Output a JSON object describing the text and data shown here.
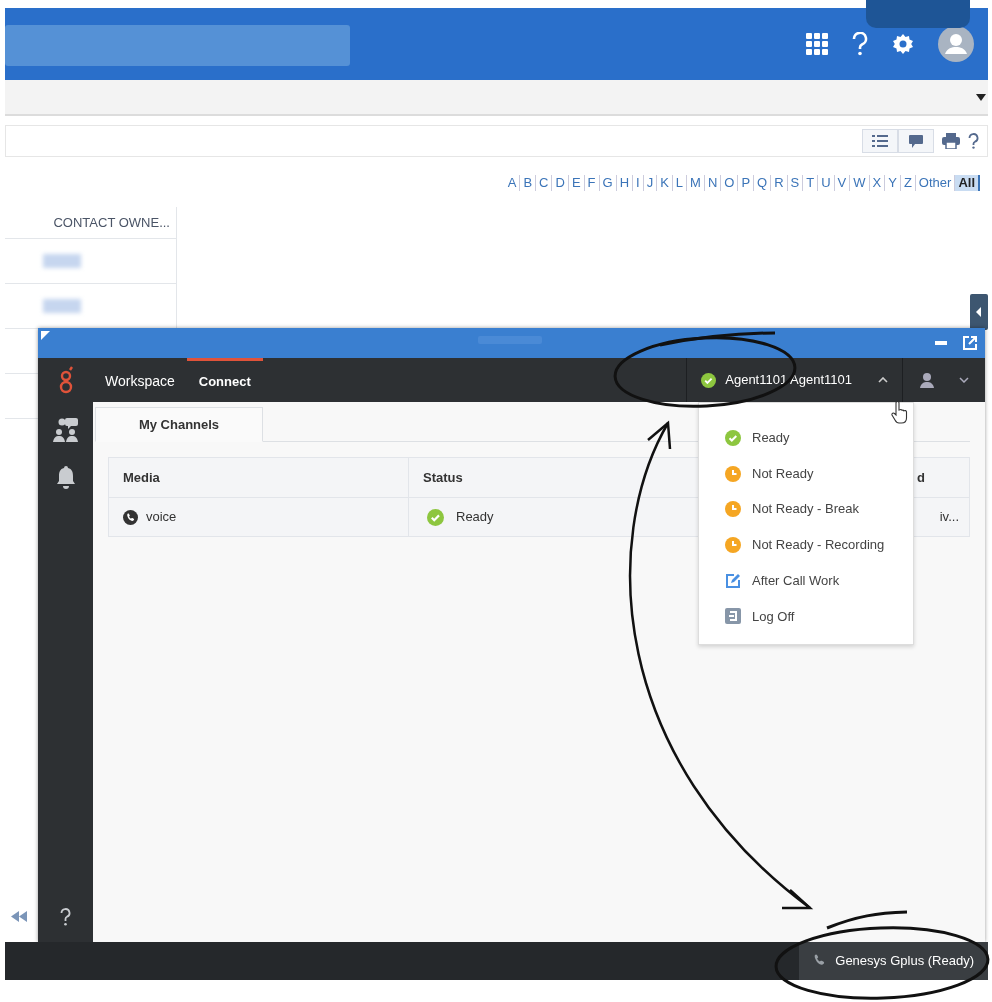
{
  "alphabet_filter": [
    {
      "label": "A",
      "selected": false
    },
    {
      "label": "B",
      "selected": false
    },
    {
      "label": "C",
      "selected": false
    },
    {
      "label": "D",
      "selected": false
    },
    {
      "label": "E",
      "selected": false
    },
    {
      "label": "F",
      "selected": false
    },
    {
      "label": "G",
      "selected": false
    },
    {
      "label": "H",
      "selected": false
    },
    {
      "label": "I",
      "selected": false
    },
    {
      "label": "J",
      "selected": false
    },
    {
      "label": "K",
      "selected": false
    },
    {
      "label": "L",
      "selected": false
    },
    {
      "label": "M",
      "selected": false
    },
    {
      "label": "N",
      "selected": false
    },
    {
      "label": "O",
      "selected": false
    },
    {
      "label": "P",
      "selected": false
    },
    {
      "label": "Q",
      "selected": false
    },
    {
      "label": "R",
      "selected": false
    },
    {
      "label": "S",
      "selected": false
    },
    {
      "label": "T",
      "selected": false
    },
    {
      "label": "U",
      "selected": false
    },
    {
      "label": "V",
      "selected": false
    },
    {
      "label": "W",
      "selected": false
    },
    {
      "label": "X",
      "selected": false
    },
    {
      "label": "Y",
      "selected": false
    },
    {
      "label": "Z",
      "selected": false
    },
    {
      "label": "Other",
      "selected": false
    },
    {
      "label": "All",
      "selected": true
    }
  ],
  "contacts_table": {
    "columns": [
      "CONTACT OWNE..."
    ]
  },
  "workspace": {
    "nav": [
      {
        "label": "Workspace",
        "selected": false
      },
      {
        "label": "Connect",
        "selected": true
      }
    ],
    "agent": {
      "name": "Agent1101 Agent1101",
      "kind": "ready",
      "menu_expanded": true
    },
    "status_menu": [
      {
        "label": "Ready",
        "kind": "ready"
      },
      {
        "label": "Not Ready",
        "kind": "not-ready"
      },
      {
        "label": "Not Ready - Break",
        "kind": "not-ready"
      },
      {
        "label": "Not Ready - Recording",
        "kind": "not-ready"
      },
      {
        "label": "After Call Work",
        "kind": "after-call-work"
      },
      {
        "label": "Log Off",
        "kind": "log-off"
      }
    ],
    "tabs": [
      {
        "label": "My Channels",
        "selected": true
      }
    ],
    "channels": {
      "columns": [
        "Media",
        "Status",
        "d"
      ],
      "rows": [
        {
          "media": "voice",
          "status": "Ready",
          "kind": "ready",
          "column_3": "iv..."
        }
      ]
    }
  },
  "status_bar": {
    "label": "Genesys Gplus (Ready)"
  }
}
